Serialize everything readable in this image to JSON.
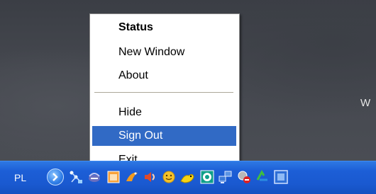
{
  "desktop": {
    "partial_text": "W"
  },
  "context_menu": {
    "items": [
      {
        "label": "Status",
        "bold": true
      },
      {
        "label": "New Window"
      },
      {
        "label": "About"
      },
      {
        "label": "Hide"
      },
      {
        "label": "Sign Out",
        "selected": true
      },
      {
        "label": "Exit"
      }
    ]
  },
  "taskbar": {
    "language": "PL",
    "tray_icons": [
      "network-icon",
      "headset-icon",
      "orange-window-icon",
      "gecko-icon",
      "volume-icon",
      "smiley-icon",
      "yellow-creature-icon",
      "green-app-icon",
      "network-computers-icon",
      "security-icon",
      "recycle-icon",
      "blue-app-icon"
    ]
  },
  "colors": {
    "taskbar": "#1a59d0",
    "menu_highlight": "#316ac5",
    "desktop": "#45484f"
  }
}
